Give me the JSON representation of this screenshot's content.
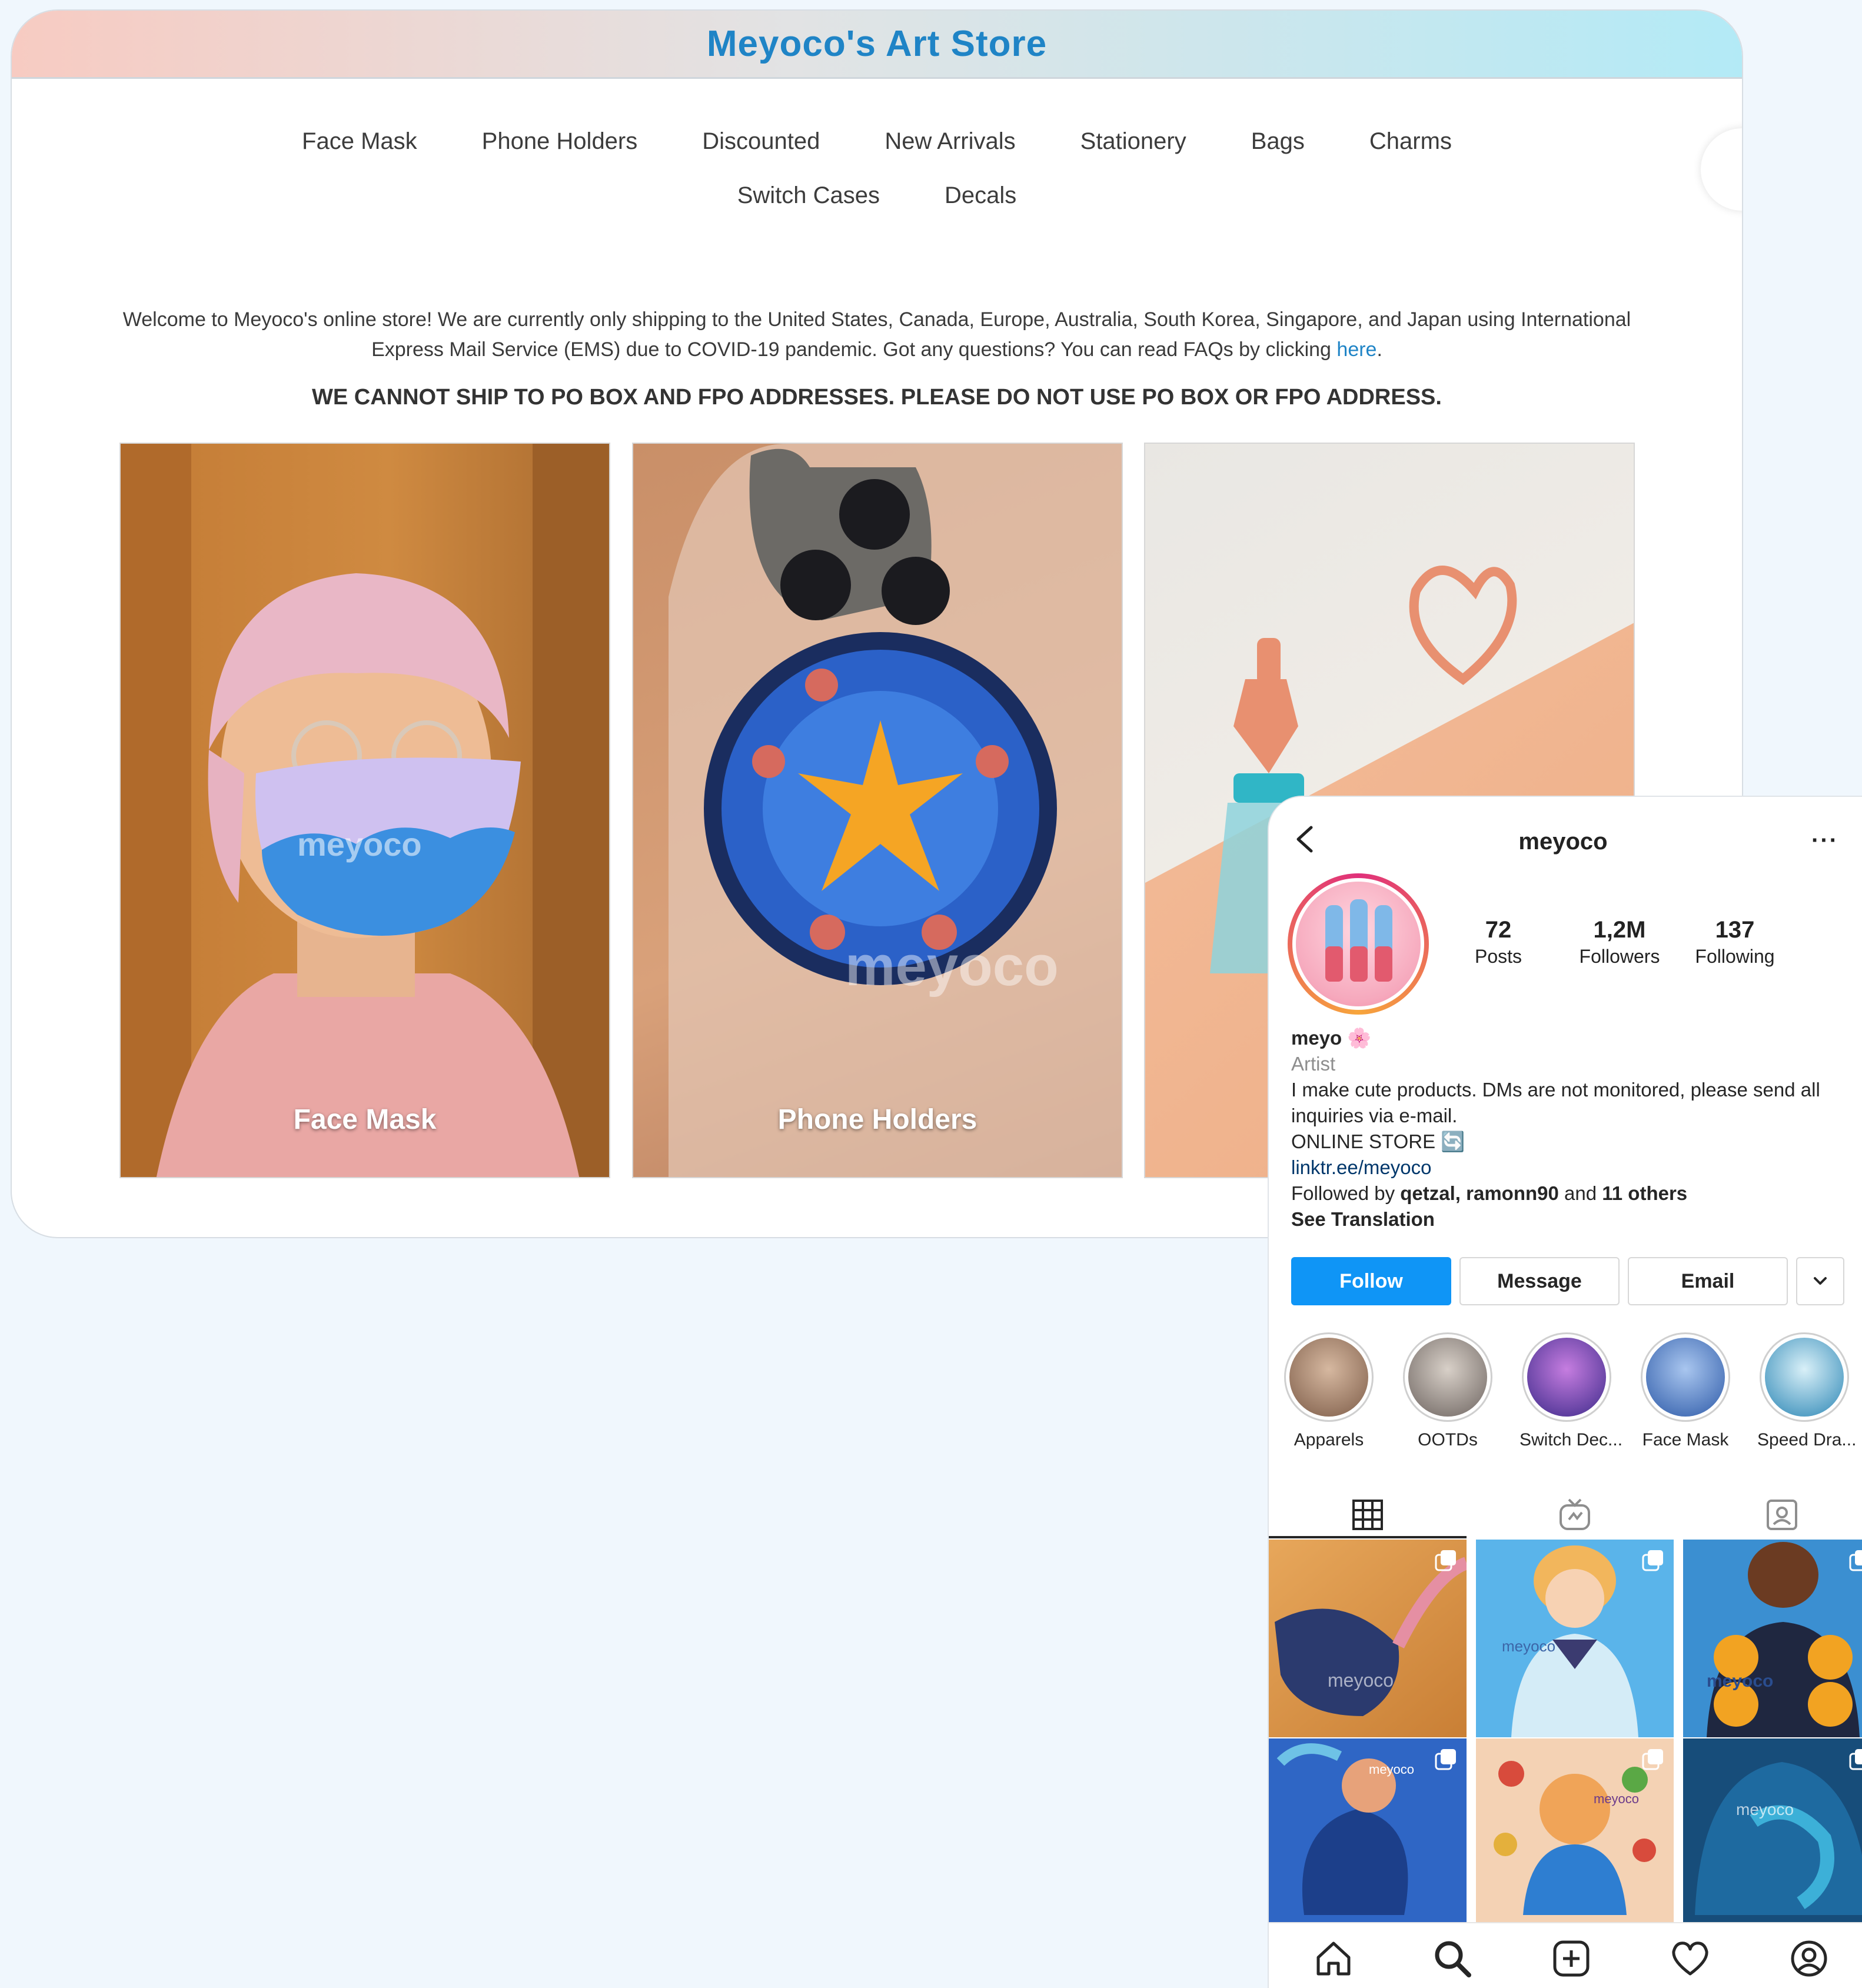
{
  "store": {
    "title": "Meyoco's Art Store",
    "nav_row1": [
      "Face Mask",
      "Phone Holders",
      "Discounted",
      "New Arrivals",
      "Stationery",
      "Bags",
      "Charms"
    ],
    "nav_row2": [
      "Switch Cases",
      "Decals"
    ],
    "welcome_text": "Welcome to Meyoco's online store! We are currently only shipping to the United States, Canada, Europe, Australia, South Korea, Singapore, and Japan using International Express Mail Service (EMS) due to COVID-19 pandemic. Got any questions? You can read FAQs by clicking ",
    "welcome_link": "here",
    "welcome_end": ".",
    "warning": "WE CANNOT SHIP TO PO BOX AND FPO ADDRESSES. PLEASE DO NOT USE PO BOX OR FPO ADDRESS.",
    "cards": [
      {
        "label": "Face Mask"
      },
      {
        "label": "Phone Holders"
      },
      {
        "label": ""
      }
    ],
    "watermark": "meyoco"
  },
  "instagram": {
    "username": "meyoco",
    "more": "···",
    "stats": [
      {
        "value": "72",
        "label": "Posts"
      },
      {
        "value": "1,2M",
        "label": "Followers"
      },
      {
        "value": "137",
        "label": "Following"
      }
    ],
    "name": "meyo 🌸",
    "category": "Artist",
    "bio_line1": "I make cute products. DMs are not monitored, please send all inquiries via e-mail.",
    "bio_line2": "ONLINE STORE 🔄",
    "link": "linktr.ee/meyoco",
    "followed_prefix": "Followed by ",
    "followed_names": "qetzal, ramonn90",
    "followed_and": " and ",
    "followed_others": "11 others",
    "see_translation": "See Translation",
    "buttons": {
      "follow": "Follow",
      "message": "Message",
      "email": "Email"
    },
    "highlights": [
      {
        "label": "Apparels",
        "color": "#b98a6d"
      },
      {
        "label": "OOTDs",
        "color": "#9a8f86"
      },
      {
        "label": "Switch Dec...",
        "color": "#6a4fb0"
      },
      {
        "label": "Face Mask",
        "color": "#5d86c9"
      },
      {
        "label": "Speed Dra...",
        "color": "#4aa7c8"
      }
    ],
    "posts": [
      {
        "name": "post-bag",
        "colors": [
          "#d99a52",
          "#2b3a6e"
        ]
      },
      {
        "name": "post-jacket-girl",
        "colors": [
          "#5ab4ea",
          "#f0c07a"
        ]
      },
      {
        "name": "post-sunflower-shirt",
        "colors": [
          "#3b8fd1",
          "#f2a322"
        ]
      },
      {
        "name": "post-mermaid",
        "colors": [
          "#2f66c5",
          "#6ec2e6"
        ]
      },
      {
        "name": "post-food-illustration",
        "colors": [
          "#f4d2b4",
          "#2e7ed1"
        ]
      },
      {
        "name": "post-wave-shirt",
        "colors": [
          "#174d7a",
          "#3cb0d8"
        ]
      }
    ],
    "post_watermark": "meyoco"
  }
}
